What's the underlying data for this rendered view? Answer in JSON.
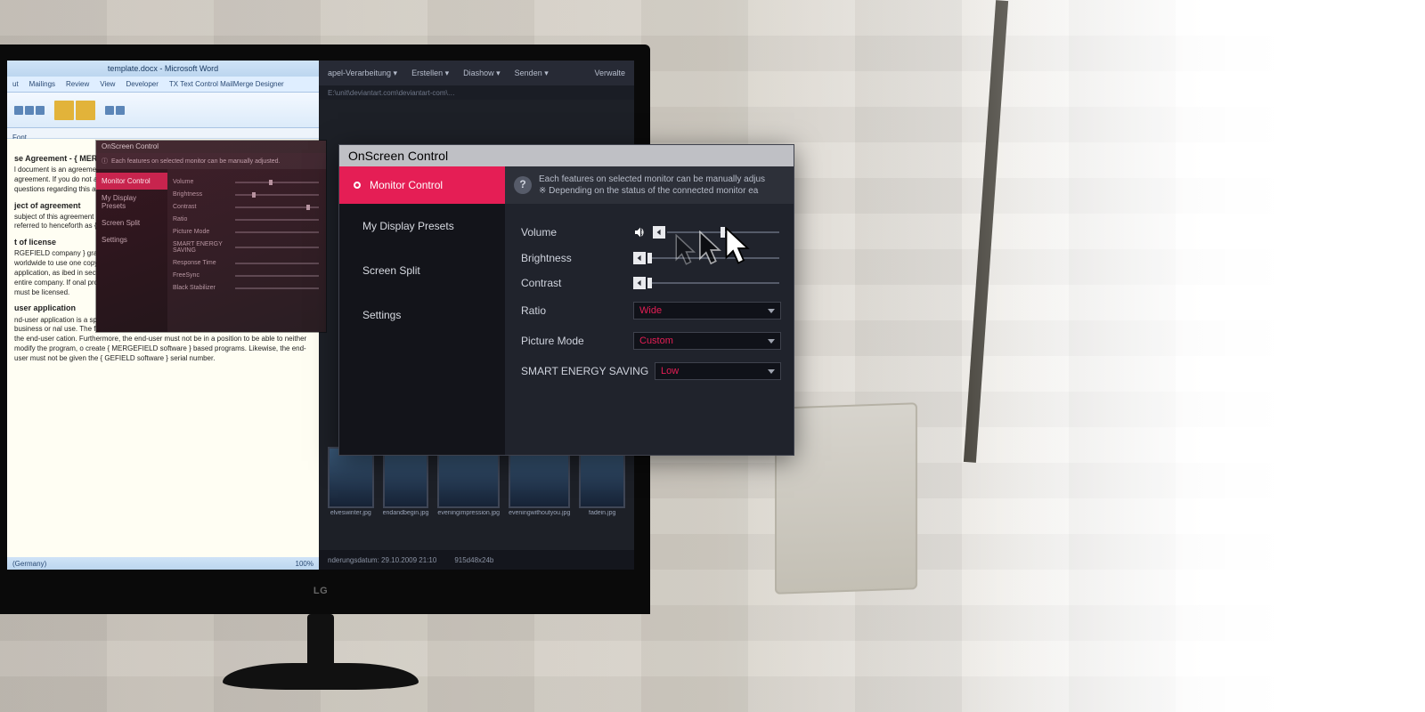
{
  "ambient": {
    "monitor_logo": "LG"
  },
  "word": {
    "title": "template.docx - Microsoft Word",
    "tabs": [
      "ut",
      "Mailings",
      "Review",
      "View",
      "Developer",
      "TX Text Control MailMerge Designer"
    ],
    "ruler_label": "Font",
    "doc": {
      "h1": "se Agreement - { MERG",
      "p1": "l document is an agreement betwe { MERGEFIELD sof } By installing { MERGEFIELD sof agreement. If you do not agree to the with all the other material which cor h files. For questions regarding this a",
      "h2": "ject of agreement",
      "p2": "subject of this agreement is the sof files and all other accompanying material. It will be referred to henceforth as { MERGEFIELD software",
      "h3": "t of license",
      "p3": "RGEFIELD company } grants the Licensee a non-exclusive, non-transferable, personal and worldwide to use one copy of { MERGEFIELD software } in the development of an end-user application, as ibed in section 3 (below). This license is for a single developer and not for an entire company. If onal programmers wish to use { MERGEFIELD software } additional copies must be licensed.",
      "h4": "user application",
      "p4": "nd-user application is a specific application program that is licensed to a person or firm for business or nal use. The files which are not listed under section 5 must not be included with the end-user cation. Furthermore, the end-user must not be in a position to be able to neither modify the program, o create { MERGEFIELD software } based programs. Likewise, the end-user must not be given the { GEFIELD software } serial number."
    },
    "status_left": "(Germany)",
    "status_right": "100%"
  },
  "right_app": {
    "menu": [
      "apel-Verarbeitung ▾",
      "Erstellen ▾",
      "Diashow ▾",
      "Senden ▾"
    ],
    "menu_right": "Verwalte",
    "sub": "E:\\unit\\deviantart.com\\deviantart-com\\…",
    "thumbs": [
      "elveswinter.jpg",
      "endandbegin.jpg",
      "eveningimpression.jpg",
      "eveningwithoutyou.jpg",
      "fadein.jpg"
    ],
    "status_left": "nderungsdatum: 29.10.2009 21:10",
    "status_right": "915d48x24b"
  },
  "small_osc": {
    "title": "OnScreen Control",
    "side": [
      "Monitor Control",
      "My Display Presets",
      "Screen Split",
      "Settings"
    ],
    "info": "Each features on selected monitor can be manually adjusted.",
    "rows": [
      "Volume",
      "Brightness",
      "Contrast",
      "Ratio",
      "Picture Mode",
      "SMART ENERGY SAVING",
      "Response Time",
      "FreeSync",
      "Black Stabilizer"
    ]
  },
  "osc": {
    "title": "OnScreen Control",
    "side": {
      "items": [
        "Monitor Control",
        "My Display Presets",
        "Screen Split",
        "Settings"
      ],
      "active_index": 0
    },
    "info_line1": "Each features on selected monitor can be manually adjus",
    "info_line2": "※ Depending on the status of the connected monitor ea",
    "controls": {
      "volume": {
        "label": "Volume",
        "value_pct": 48
      },
      "brightness": {
        "label": "Brightness",
        "value_pct": 0
      },
      "contrast": {
        "label": "Contrast",
        "value_pct": 0
      },
      "ratio": {
        "label": "Ratio",
        "selected": "Wide"
      },
      "picture_mode": {
        "label": "Picture Mode",
        "selected": "Custom"
      },
      "smart_energy": {
        "label": "SMART ENERGY SAVING",
        "selected": "Low"
      }
    }
  }
}
